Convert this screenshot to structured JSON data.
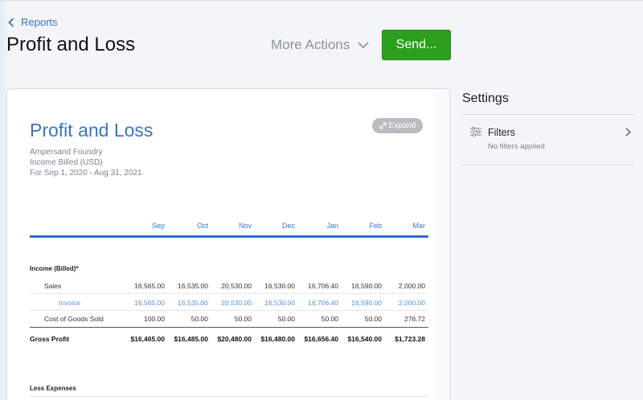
{
  "header": {
    "back_label": "Reports",
    "title": "Profit and Loss",
    "more_actions_label": "More Actions",
    "send_label": "Send..."
  },
  "report": {
    "title": "Profit and Loss",
    "expand_label": "Expand",
    "company": "Ampersand Foundry",
    "basis": "Income Billed (USD)",
    "period": "For Sep 1, 2020 - Aug 31, 2021",
    "months": [
      "Sep",
      "Oct",
      "Nov",
      "Dec",
      "Jan",
      "Feb",
      "Mar"
    ],
    "income_section": "Income (Billed)*",
    "rows": {
      "sales": {
        "label": "Sales",
        "values": [
          "16,565.00",
          "16,535.00",
          "20,530.00",
          "16,530.00",
          "16,706.40",
          "16,590.00",
          "2,000.00"
        ]
      },
      "invoice": {
        "label": "Invoice",
        "values": [
          "16,565.00",
          "16,535.00",
          "20,530.00",
          "16,530.00",
          "16,706.40",
          "16,590.00",
          "2,000.00"
        ]
      },
      "cogs": {
        "label": "Cost of Goods Sold",
        "values": [
          "100.00",
          "50.00",
          "50.00",
          "50.00",
          "50.00",
          "50.00",
          "276.72"
        ]
      },
      "gross_profit": {
        "label": "Gross Profit",
        "values": [
          "$16,465.00",
          "$16,485.00",
          "$20,480.00",
          "$16,480.00",
          "$16,656.40",
          "$16,540.00",
          "$1,723.28"
        ]
      }
    },
    "expenses_section": "Less Expenses"
  },
  "settings": {
    "title": "Settings",
    "filters_label": "Filters",
    "filters_status": "No filters applied"
  },
  "colors": {
    "accent": "#3a74c4",
    "send_green": "#2ca01c",
    "rule_blue": "#2f6ac8"
  }
}
